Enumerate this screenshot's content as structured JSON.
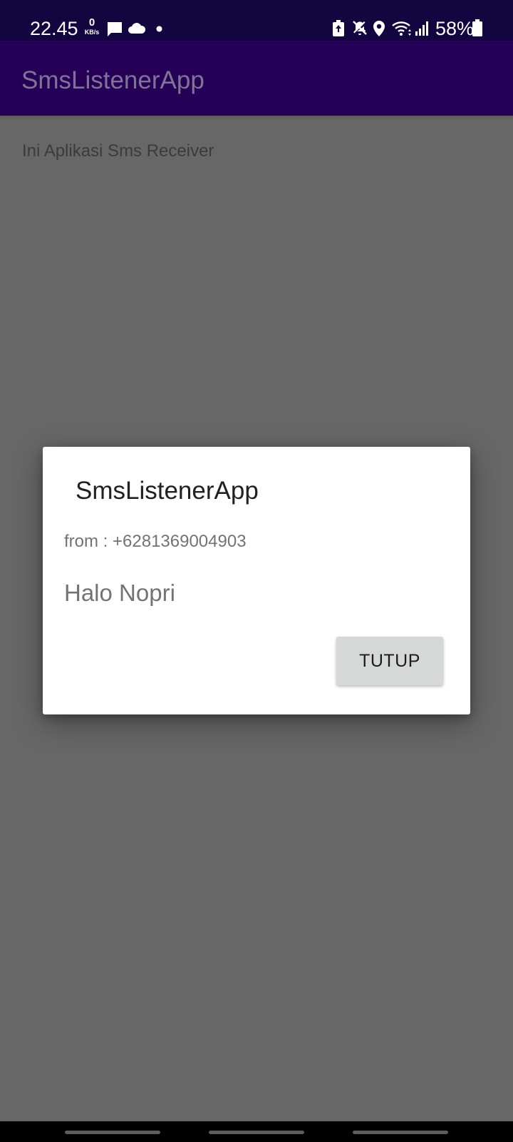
{
  "status_bar": {
    "time": "22.45",
    "net_speed_value": "0",
    "net_speed_unit": "KB/s",
    "battery_percent": "58%",
    "icons": [
      "message-icon",
      "cloud-icon",
      "dot-icon",
      "battery-saver-icon",
      "mute-icon",
      "location-icon",
      "wifi-icon",
      "signal-icon",
      "battery-icon"
    ]
  },
  "app_bar": {
    "title": "SmsListenerApp"
  },
  "main": {
    "text": "Ini Aplikasi Sms Receiver"
  },
  "dialog": {
    "title": "SmsListenerApp",
    "from": "from : +6281369004903",
    "message": "Halo Nopri",
    "button_label": "TUTUP"
  },
  "colors": {
    "status_bar": "#13053f",
    "app_bar": "#260057",
    "scrim_background": "#676767",
    "dialog": "#ffffff",
    "button": "#d6d7d7"
  }
}
